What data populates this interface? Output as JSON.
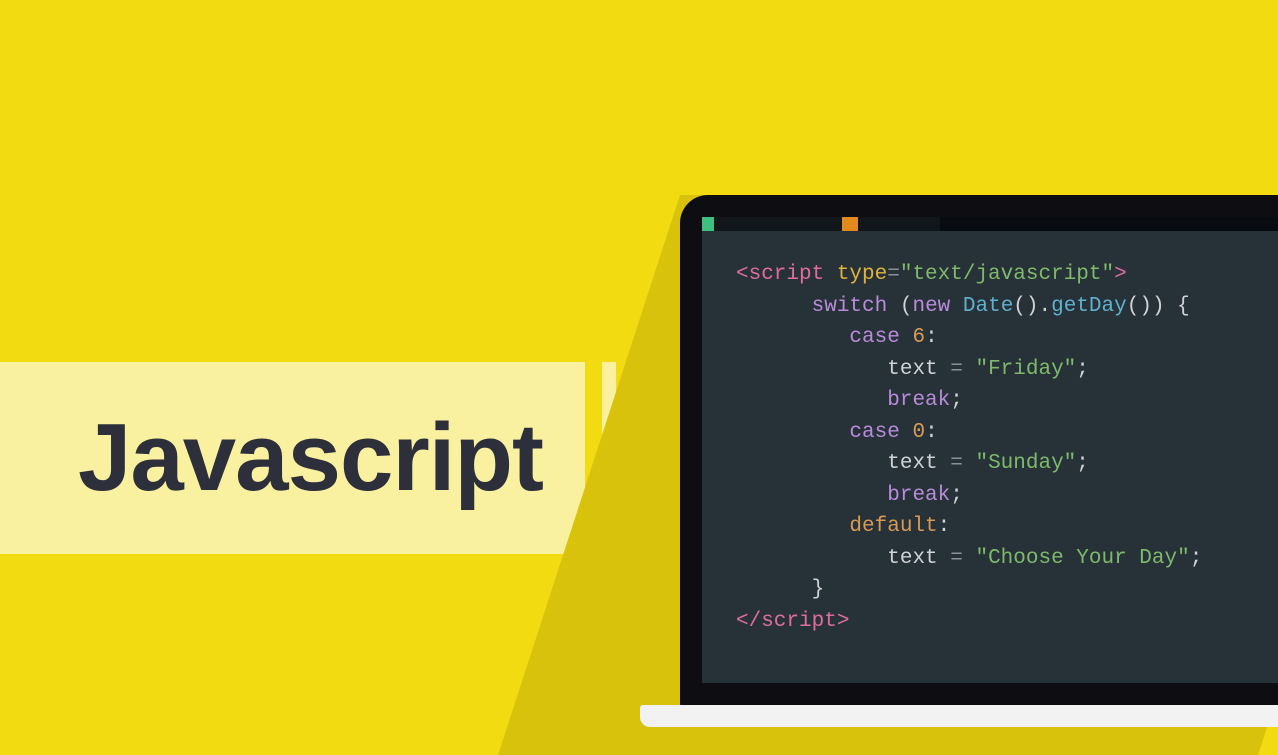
{
  "title": "Javascript",
  "code": {
    "l1_open": "<script",
    "l1_attr": " type",
    "l1_eq": "=",
    "l1_val": "\"text/javascript\"",
    "l1_close": ">",
    "l2_switch": "switch",
    "l2_paren_open": " (",
    "l2_new": "new",
    "l2_date": " Date",
    "l2_c1": "().",
    "l2_getday": "getDay",
    "l2_c2": "()) {",
    "l3_case": "case",
    "l3_num": " 6",
    "l3_colon": ":",
    "l4_text": "text ",
    "l4_eq": "= ",
    "l4_val": "\"Friday\"",
    "l4_semi": ";",
    "l5_break": "break",
    "l5_semi": ";",
    "l6_case": "case",
    "l6_num": " 0",
    "l6_colon": ":",
    "l7_text": "text ",
    "l7_eq": "= ",
    "l7_val": "\"Sunday\"",
    "l7_semi": ";",
    "l8_break": "break",
    "l8_semi": ";",
    "l9_default": "default",
    "l9_colon": ":",
    "l10_text": "text ",
    "l10_eq": "= ",
    "l10_val": "\"Choose Your Day\"",
    "l10_semi": ";",
    "l11_brace": "}",
    "l12_close": "</script",
    "l12_gt": ">"
  }
}
